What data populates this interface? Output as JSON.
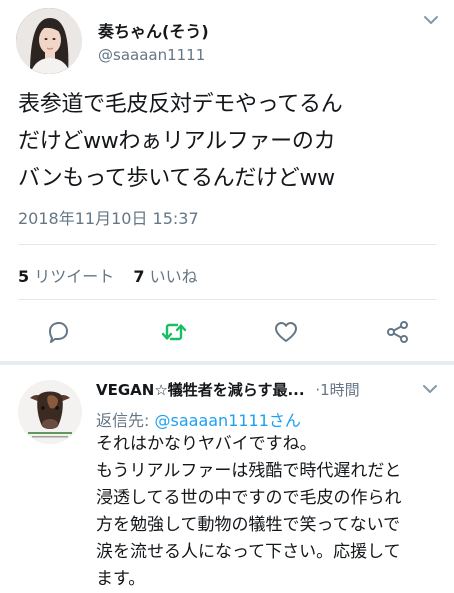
{
  "main_tweet": {
    "display_name": "奏ちゃん(そう)",
    "handle": "@saaaan1111",
    "text": "表参道で毛皮反対デモやってるん\nだけどwwわぁリアルファーのカ\nバンもって歩いてるんだけどww",
    "timestamp": "2018年11月10日 15:37",
    "retweet_count": "5",
    "retweet_label": "リツイート",
    "like_count": "7",
    "like_label": "いいね",
    "avatar_icon": "user-photo-avatar",
    "menu_icon": "chevron-down-icon"
  },
  "actions": {
    "reply_icon": "reply-icon",
    "retweet_icon": "retweet-icon",
    "like_icon": "heart-icon",
    "share_icon": "share-icon",
    "retweet_color": "#17bf63",
    "icon_color": "#657786"
  },
  "reply_tweet": {
    "display_name": "VEGAN☆犠牲者を減らす最...",
    "time_sep": "·",
    "time_ago": "1時間",
    "replying_label": "返信先:",
    "replying_to": "@saaaan1111さん",
    "text": "それはかなりヤバイですね。\nもうリアルファーは残酷で時代遅れだと\n浸透してる世の中ですので毛皮の作られ\n方を勉強して動物の犠牲で笑ってないで\n涙を流せる人になって下さい。応援して\nます。",
    "avatar_icon": "cow-avatar"
  },
  "colors": {
    "text_primary": "#14171a",
    "text_secondary": "#657786",
    "link": "#1da1f2",
    "divider": "#e1e8ed"
  }
}
